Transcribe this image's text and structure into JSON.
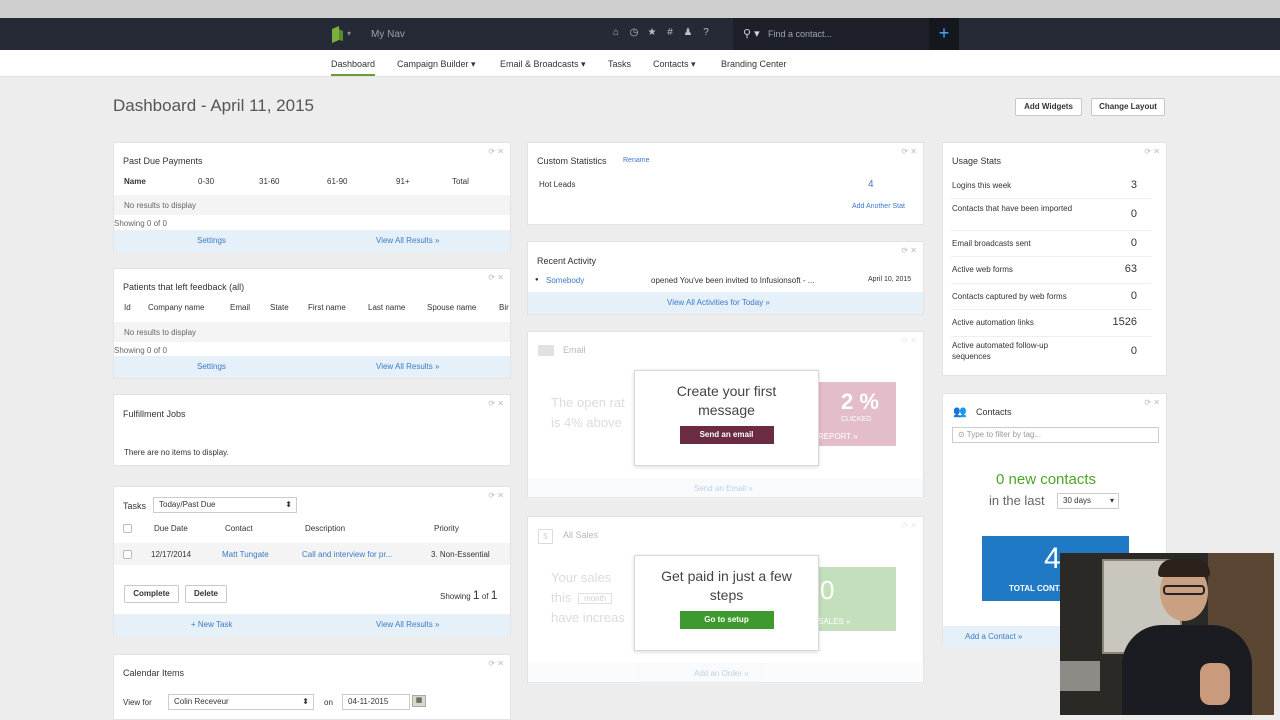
{
  "nav": {
    "my_nav": "My Nav",
    "search_placeholder": "Find a contact...",
    "plus": "+"
  },
  "subnav": {
    "dashboard": "Dashboard",
    "campaign_builder": "Campaign Builder",
    "email_broadcasts": "Email & Broadcasts",
    "tasks": "Tasks",
    "contacts": "Contacts",
    "branding_center": "Branding Center"
  },
  "page": {
    "title": "Dashboard - April 11, 2015",
    "add_widgets": "Add Widgets",
    "change_layout": "Change Layout"
  },
  "past_due": {
    "title": "Past Due Payments",
    "columns": [
      "Name",
      "0-30",
      "31-60",
      "61-90",
      "91+",
      "Total"
    ],
    "empty": "No results to display",
    "showing": "Showing 0 of 0",
    "settings": "Settings",
    "view_all": "View All Results »"
  },
  "feedback": {
    "title": "Patients that left feedback (all)",
    "columns": [
      "Id",
      "Company name",
      "Email",
      "State",
      "First name",
      "Last name",
      "Spouse name",
      "Bir"
    ],
    "empty": "No results to display",
    "showing": "Showing 0 of 0",
    "settings": "Settings",
    "view_all": "View All Results »"
  },
  "fulfillment": {
    "title": "Fulfillment Jobs",
    "empty": "There are no items to display."
  },
  "tasks": {
    "title": "Tasks",
    "filter": "Today/Past Due",
    "columns": [
      "Due Date",
      "Contact",
      "Description",
      "Priority"
    ],
    "row": {
      "date": "12/17/2014",
      "contact": "Matt Tungate",
      "description": "Call and interview for pr...",
      "priority": "3. Non-Essential"
    },
    "complete": "Complete",
    "delete": "Delete",
    "showing_prefix": "Showing",
    "showing_current": "1",
    "showing_of": "of",
    "showing_total": "1",
    "new_task": "+ New Task",
    "view_all": "View All Results »"
  },
  "calendar": {
    "title": "Calendar Items",
    "view_for": "View for",
    "user": "Colin Receveur",
    "on": "on",
    "date": "04-11-2015"
  },
  "custom_stats": {
    "title": "Custom Statistics",
    "rename": "Rename",
    "label": "Hot Leads",
    "value": "4",
    "add": "Add Another Stat"
  },
  "recent_activity": {
    "title": "Recent Activity",
    "who": "Somebody",
    "what": "opened You've been invited to Infusionsoft - ...",
    "when": "April 10, 2015",
    "view_all": "View All Activities for Today »"
  },
  "email_widget": {
    "title": "Email",
    "bg_text1": "The open rat",
    "bg_text2": "is 4% above",
    "pct": "2 %",
    "clicked": "CLICKED",
    "report": "REPORT »",
    "footer": "Send an Email »",
    "overlay_title": "Create your first message",
    "overlay_button": "Send an email"
  },
  "sales_widget": {
    "title": "All Sales",
    "bg_text1": "Your sales",
    "bg_text2": "this",
    "bg_text2b": "month",
    "bg_text3": "have increas",
    "value": "0",
    "sales": "SALES »",
    "footer": "Add an Order »",
    "overlay_title": "Get paid in just a few steps",
    "overlay_button": "Go to setup"
  },
  "usage": {
    "title": "Usage Stats",
    "rows": [
      {
        "label": "Logins this week",
        "value": "3"
      },
      {
        "label": "Contacts that have been imported",
        "value": "0"
      },
      {
        "label": "Email broadcasts sent",
        "value": "0"
      },
      {
        "label": "Active web forms",
        "value": "63"
      },
      {
        "label": "Contacts captured by web forms",
        "value": "0"
      },
      {
        "label": "Active automation links",
        "value": "1526"
      },
      {
        "label": "Active automated follow-up sequences",
        "value": "0"
      }
    ]
  },
  "contacts_widget": {
    "title": "Contacts",
    "filter_placeholder": "Type to filter by tag...",
    "new_contacts": "0 new contacts",
    "in_the_last": "in the last",
    "period": "30 days",
    "total_value": "4",
    "total_label": "TOTAL CONTACTS",
    "add": "Add a Contact »"
  },
  "colors": {
    "nav_bg": "#262a36",
    "accent_green": "#6a9d3a",
    "link_blue": "#3a7bc8",
    "email_button": "#6b2b42",
    "setup_button": "#3e9a2e",
    "contacts_box": "#1f79c4",
    "new_contacts_green": "#4ea42b"
  }
}
